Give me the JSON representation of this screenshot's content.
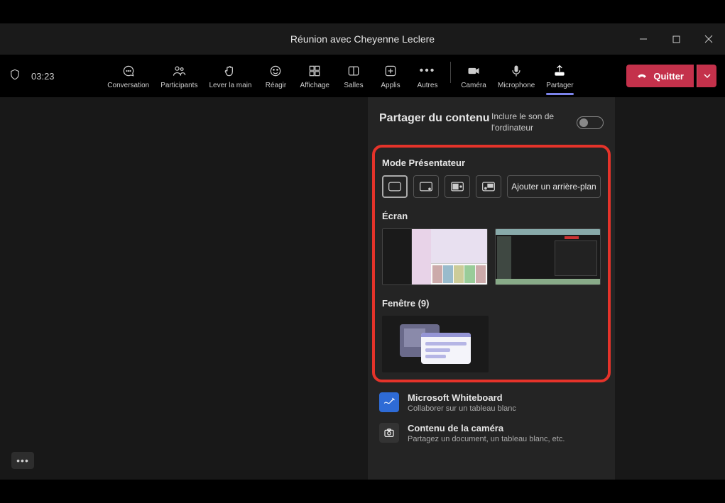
{
  "titlebar": {
    "title": "Réunion avec Cheyenne Leclere"
  },
  "status": {
    "time": "03:23"
  },
  "toolbar": {
    "conversation": "Conversation",
    "participants": "Participants",
    "raise_hand": "Lever la main",
    "react": "Réagir",
    "view": "Affichage",
    "rooms": "Salles",
    "apps": "Applis",
    "more": "Autres",
    "camera": "Caméra",
    "microphone": "Microphone",
    "share": "Partager",
    "leave": "Quitter"
  },
  "share_panel": {
    "title": "Partager du contenu",
    "include_audio": "Inclure le son de l'ordinateur",
    "presenter_mode": "Mode Présentateur",
    "add_background": "Ajouter un arrière-plan",
    "screen": "Écran",
    "window": "Fenêtre (9)",
    "whiteboard_title": "Microsoft Whiteboard",
    "whiteboard_sub": "Collaborer sur un tableau blanc",
    "camera_content_title": "Contenu de la caméra",
    "camera_content_sub": "Partagez un document, un tableau blanc, etc."
  }
}
